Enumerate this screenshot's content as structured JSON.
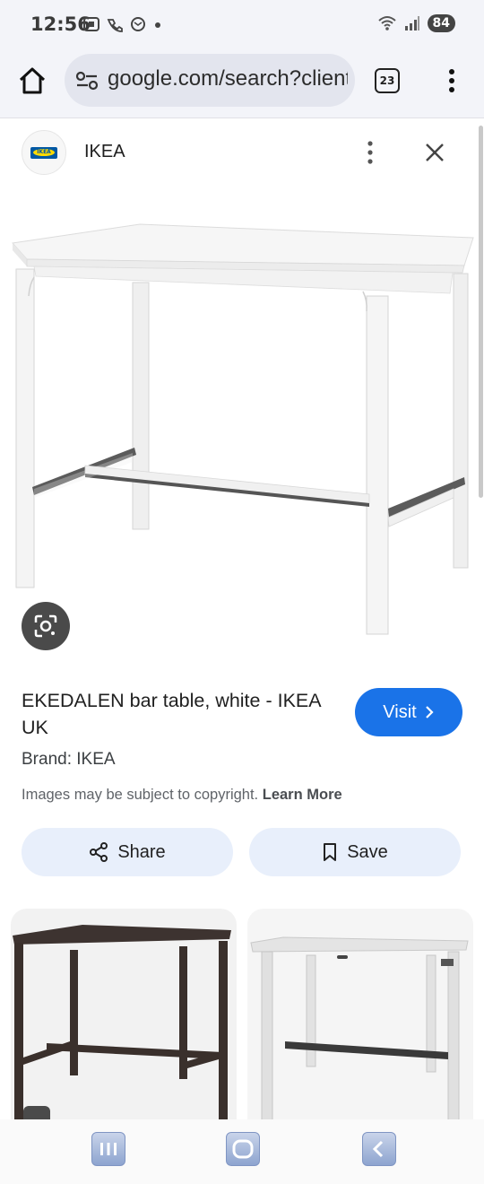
{
  "status": {
    "time": "12:56",
    "battery": "84"
  },
  "toolbar": {
    "url": "google.com/search?client=ms-android-samsung",
    "tab_count": "23"
  },
  "source": {
    "name": "IKEA"
  },
  "result": {
    "title": "EKEDALEN bar table, white - IKEA UK",
    "brand_line": "Brand: IKEA",
    "copyright_text": "Images may be subject to copyright.",
    "learn_more": "Learn More",
    "visit_label": "Visit",
    "share_label": "Share",
    "save_label": "Save"
  },
  "colors": {
    "accent": "#1a73e8",
    "chip_bg": "#e8effb",
    "toolbar_bg": "#f3f4f9"
  }
}
